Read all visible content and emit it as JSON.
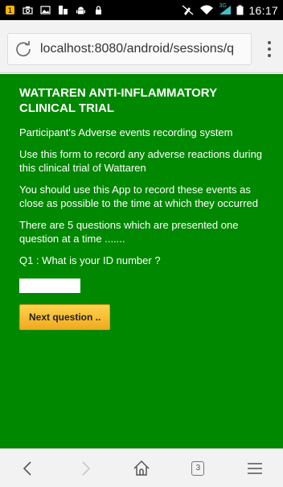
{
  "status_bar": {
    "time": "16:17",
    "network_type": "3G",
    "left_icons": [
      "notification-icon",
      "camera-icon",
      "gallery-icon",
      "app-icon",
      "android-icon",
      "lock-icon"
    ],
    "right_icons": [
      "mute-icon",
      "wifi-icon",
      "signal-icon",
      "battery-icon"
    ]
  },
  "browser": {
    "url": "localhost:8080/android/sessions/q",
    "tab_count": "3"
  },
  "page": {
    "title": "WATTAREN ANTI-INFLAMMATORY CLINICAL TRIAL",
    "paragraphs": [
      "Participant's Adverse events recording system",
      "Use this form to record any adverse reactions during this clinical trial of Wattaren",
      "You should use this App to record these events as close as possible to the time at which they occurred",
      "There are 5 questions which are presented one question at a time .......",
      "Q1 : What is your ID number ?"
    ],
    "id_input_value": "",
    "next_button_label": "Next question .."
  },
  "colors": {
    "page_background": "#008800",
    "button_gradient_top": "#ffd34d",
    "button_gradient_bottom": "#f1a91f"
  }
}
